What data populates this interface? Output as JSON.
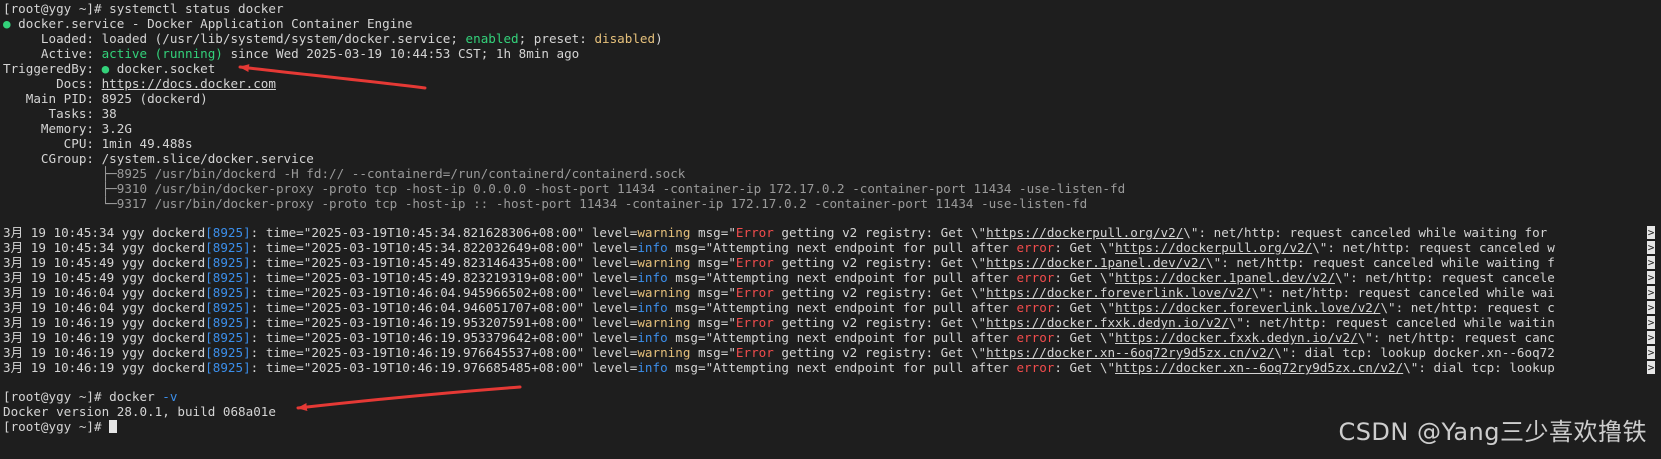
{
  "prompt1": "[root@ygy ~]# ",
  "cmd1": "systemctl status docker",
  "service": {
    "bullet": "●",
    "title": " docker.service - Docker Application Container Engine",
    "loaded_label": "     Loaded: ",
    "loaded_pre": "loaded (/usr/lib/systemd/system/docker.service; ",
    "loaded_enabled": "enabled",
    "loaded_mid": "; preset: ",
    "loaded_preset": "disabled",
    "loaded_post": ")",
    "active_label": "     Active: ",
    "active_state": "active (running)",
    "active_since": " since Wed 2025-03-19 10:44:53 CST; 1h 8min ago",
    "triggered_label": "TriggeredBy: ",
    "triggered_value": " docker.socket",
    "docs_label": "       Docs: ",
    "docs_link": "https://docs.docker.com",
    "pid_label": "   Main PID: ",
    "pid_value": "8925 (dockerd)",
    "tasks_label": "      Tasks: ",
    "tasks_value": "38",
    "memory_label": "     Memory: ",
    "memory_value": "3.2G",
    "cpu_label": "        CPU: ",
    "cpu_value": "1min 49.488s",
    "cgroup_label": "     CGroup: ",
    "cgroup_value": "/system.slice/docker.service",
    "cgroup_tree": [
      "             ├─8925 /usr/bin/dockerd -H fd:// --containerd=/run/containerd/containerd.sock",
      "             ├─9310 /usr/bin/docker-proxy -proto tcp -host-ip 0.0.0.0 -host-port 11434 -container-ip 172.17.0.2 -container-port 11434 -use-listen-fd",
      "             └─9317 /usr/bin/docker-proxy -proto tcp -host-ip :: -host-port 11434 -container-ip 172.17.0.2 -container-port 11434 -use-listen-fd"
    ]
  },
  "logs": [
    {
      "prefix": "3月 19 10:45:34 ygy dockerd",
      "pid": "[8925]",
      "time": ": time=\"2025-03-19T10:45:34.821628306+08:00\" level=",
      "level": "warning",
      "msg": " msg=\"",
      "err": "Error",
      "tail": " getting v2 registry: Get \\\"",
      "url": "https://dockerpull.org/v2/",
      "rest": "\\\": net/http: request canceled while waiting for "
    },
    {
      "prefix": "3月 19 10:45:34 ygy dockerd",
      "pid": "[8925]",
      "time": ": time=\"2025-03-19T10:45:34.822032649+08:00\" level=",
      "level": "info",
      "msg": " msg=\"Attempting next endpoint for pull after ",
      "err": "error",
      "tail": ": Get \\\"",
      "url": "https://dockerpull.org/v2/",
      "rest": "\\\": net/http: request canceled w"
    },
    {
      "prefix": "3月 19 10:45:49 ygy dockerd",
      "pid": "[8925]",
      "time": ": time=\"2025-03-19T10:45:49.823146435+08:00\" level=",
      "level": "warning",
      "msg": " msg=\"",
      "err": "Error",
      "tail": " getting v2 registry: Get \\\"",
      "url": "https://docker.1panel.dev/v2/",
      "rest": "\\\": net/http: request canceled while waiting f"
    },
    {
      "prefix": "3月 19 10:45:49 ygy dockerd",
      "pid": "[8925]",
      "time": ": time=\"2025-03-19T10:45:49.823219319+08:00\" level=",
      "level": "info",
      "msg": " msg=\"Attempting next endpoint for pull after ",
      "err": "error",
      "tail": ": Get \\\"",
      "url": "https://docker.1panel.dev/v2/",
      "rest": "\\\": net/http: request cancele"
    },
    {
      "prefix": "3月 19 10:46:04 ygy dockerd",
      "pid": "[8925]",
      "time": ": time=\"2025-03-19T10:46:04.945966502+08:00\" level=",
      "level": "warning",
      "msg": " msg=\"",
      "err": "Error",
      "tail": " getting v2 registry: Get \\\"",
      "url": "https://docker.foreverlink.love/v2/",
      "rest": "\\\": net/http: request canceled while wai"
    },
    {
      "prefix": "3月 19 10:46:04 ygy dockerd",
      "pid": "[8925]",
      "time": ": time=\"2025-03-19T10:46:04.946051707+08:00\" level=",
      "level": "info",
      "msg": " msg=\"Attempting next endpoint for pull after ",
      "err": "error",
      "tail": ": Get \\\"",
      "url": "https://docker.foreverlink.love/v2/",
      "rest": "\\\": net/http: request c"
    },
    {
      "prefix": "3月 19 10:46:19 ygy dockerd",
      "pid": "[8925]",
      "time": ": time=\"2025-03-19T10:46:19.953207591+08:00\" level=",
      "level": "warning",
      "msg": " msg=\"",
      "err": "Error",
      "tail": " getting v2 registry: Get \\\"",
      "url": "https://docker.fxxk.dedyn.io/v2/",
      "rest": "\\\": net/http: request canceled while waitin"
    },
    {
      "prefix": "3月 19 10:46:19 ygy dockerd",
      "pid": "[8925]",
      "time": ": time=\"2025-03-19T10:46:19.953379642+08:00\" level=",
      "level": "info",
      "msg": " msg=\"Attempting next endpoint for pull after ",
      "err": "error",
      "tail": ": Get \\\"",
      "url": "https://docker.fxxk.dedyn.io/v2/",
      "rest": "\\\": net/http: request canc"
    },
    {
      "prefix": "3月 19 10:46:19 ygy dockerd",
      "pid": "[8925]",
      "time": ": time=\"2025-03-19T10:46:19.976645537+08:00\" level=",
      "level": "warning",
      "msg": " msg=\"",
      "err": "Error",
      "tail": " getting v2 registry: Get \\\"",
      "url": "https://docker.xn--6oq72ry9d5zx.cn/v2/",
      "rest": "\\\": dial tcp: lookup docker.xn--6oq72"
    },
    {
      "prefix": "3月 19 10:46:19 ygy dockerd",
      "pid": "[8925]",
      "time": ": time=\"2025-03-19T10:46:19.976685485+08:00\" level=",
      "level": "info",
      "msg": " msg=\"Attempting next endpoint for pull after ",
      "err": "error",
      "tail": ": Get \\\"",
      "url": "https://docker.xn--6oq72ry9d5zx.cn/v2/",
      "rest": "\\\": dial tcp: lookup"
    }
  ],
  "prompt2": "[root@ygy ~]# ",
  "cmd2_main": "docker ",
  "cmd2_flag": "-v",
  "version_output": "Docker version 28.0.1, build 068a01e",
  "prompt3": "[root@ygy ~]# ",
  "truncation_marker": ">",
  "watermark": "CSDN @Yang三少喜欢撸铁",
  "colors": {
    "background": "#1e1e1e",
    "green": "#33d17a",
    "yellow": "#e5c07b",
    "red": "#f14c4c",
    "blue": "#3b8eea",
    "arrow": "#e53935"
  }
}
